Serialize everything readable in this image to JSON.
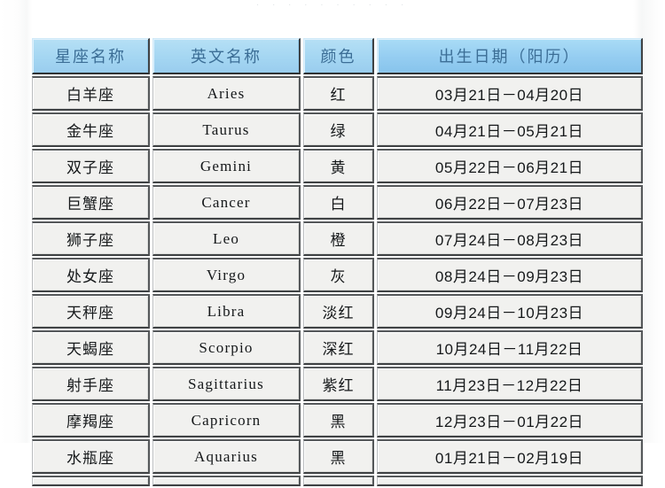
{
  "top_remnant": ". . . .   . .   . . . .",
  "colors": {
    "header_fill": "#a4d6f2",
    "header_text": "#3c6e96",
    "cell_fill": "#f1f1ef",
    "cell_text": "#15181a",
    "page_background": "#ffffff"
  },
  "table": {
    "columns": [
      {
        "key": "name",
        "label": "星座名称"
      },
      {
        "key": "en",
        "label": "英文名称"
      },
      {
        "key": "color",
        "label": "颜色"
      },
      {
        "key": "date",
        "label": "出生日期（阳历）"
      }
    ],
    "rows": [
      {
        "name": "白羊座",
        "en": "Aries",
        "color": "红",
        "date": "03月21日－04月20日"
      },
      {
        "name": "金牛座",
        "en": "Taurus",
        "color": "绿",
        "date": "04月21日－05月21日"
      },
      {
        "name": "双子座",
        "en": "Gemini",
        "color": "黄",
        "date": "05月22日－06月21日"
      },
      {
        "name": "巨蟹座",
        "en": "Cancer",
        "color": "白",
        "date": "06月22日－07月23日"
      },
      {
        "name": "狮子座",
        "en": "Leo",
        "color": "橙",
        "date": "07月24日－08月23日"
      },
      {
        "name": "处女座",
        "en": "Virgo",
        "color": "灰",
        "date": "08月24日－09月23日"
      },
      {
        "name": "天秤座",
        "en": "Libra",
        "color": "淡红",
        "date": "09月24日－10月23日"
      },
      {
        "name": "天蝎座",
        "en": "Scorpio",
        "color": "深红",
        "date": "10月24日－11月22日"
      },
      {
        "name": "射手座",
        "en": "Sagittarius",
        "color": "紫红",
        "date": "11月23日－12月22日"
      },
      {
        "name": "摩羯座",
        "en": "Capricorn",
        "color": "黑",
        "date": "12月23日－01月22日"
      },
      {
        "name": "水瓶座",
        "en": "Aquarius",
        "color": "黑",
        "date": "01月21日－02月19日"
      }
    ],
    "clipped_row": {
      "name": "",
      "en": "",
      "color": "",
      "date": ""
    }
  }
}
